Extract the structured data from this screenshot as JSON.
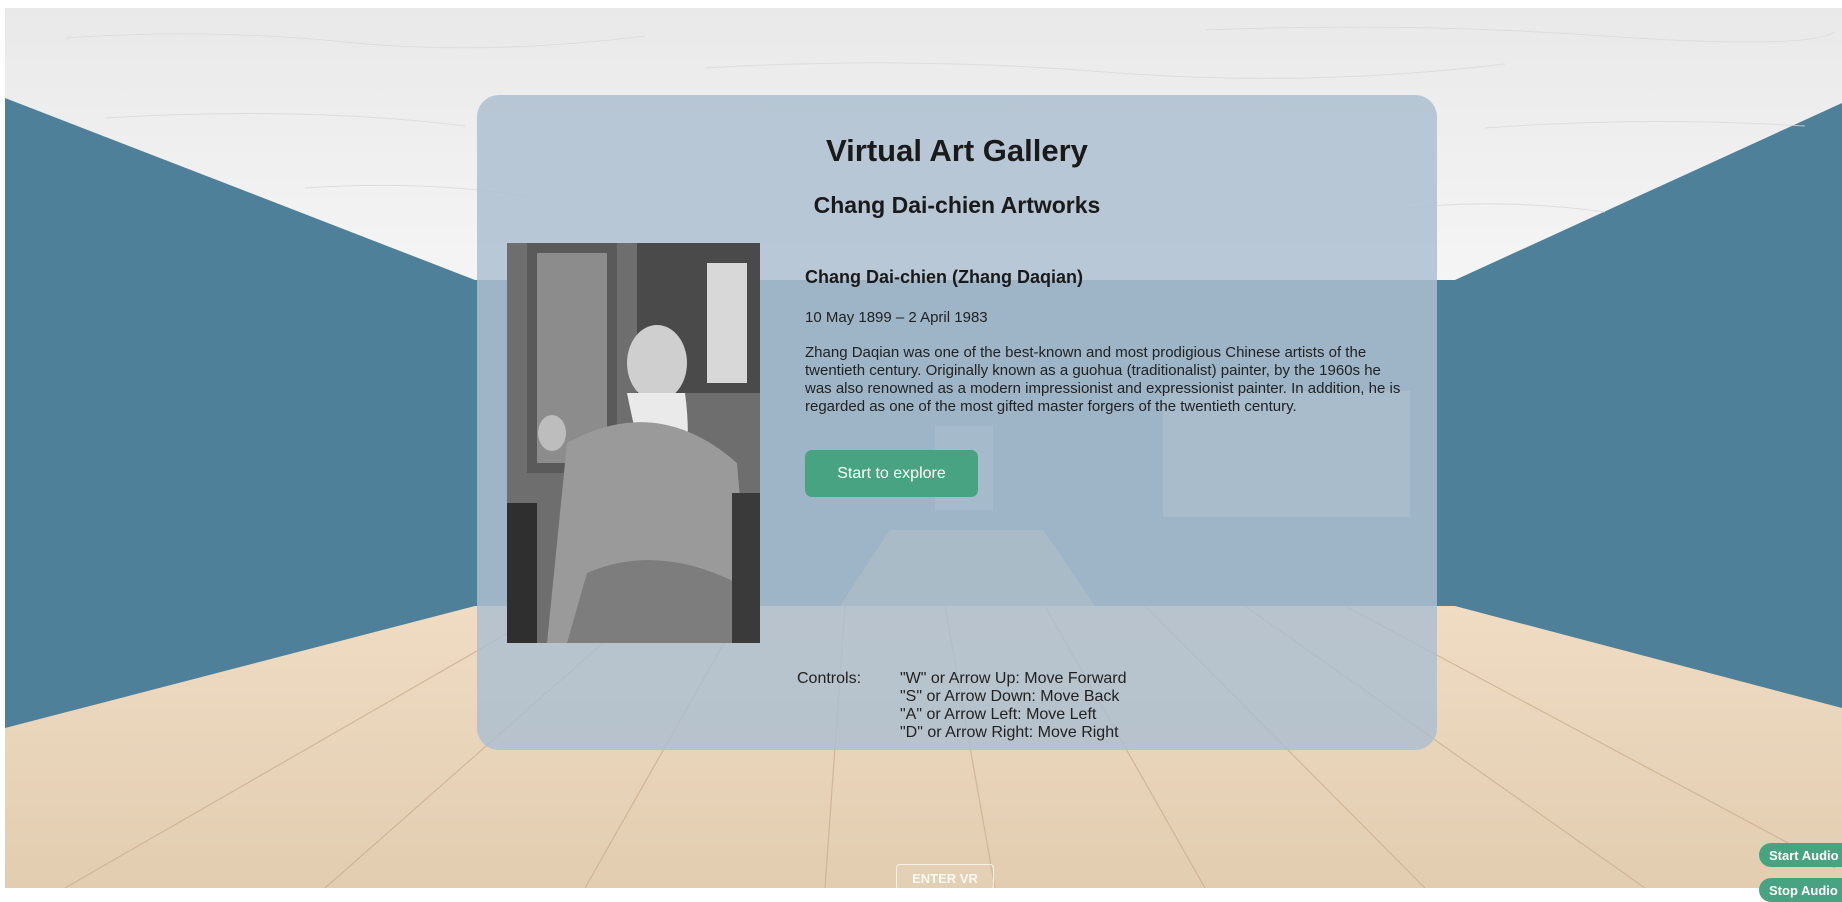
{
  "gallery": {
    "title": "Virtual Art Gallery",
    "subtitle": "Chang Dai-chien Artworks"
  },
  "artist": {
    "name": "Chang Dai-chien (Zhang Daqian)",
    "dates": "10 May 1899 – 2 April 1983",
    "bio": "Zhang Daqian was one of the best-known and most prodigious Chinese artists of the twentieth century. Originally known as a guohua (traditionalist) painter, by the 1960s he was also renowned as a modern impressionist and expressionist painter. In addition, he is regarded as one of the most gifted master forgers of the twentieth century."
  },
  "actions": {
    "explore_label": "Start to explore",
    "enter_vr_label": "ENTER VR",
    "audio_start_label": "Start Audio Guide",
    "audio_stop_label": "Stop Audio Guide"
  },
  "controls": {
    "label": "Controls:",
    "items": [
      "\"W\" or Arrow Up: Move Forward",
      "\"S\" or Arrow Down: Move Back",
      "\"A\" or Arrow Left: Move Left",
      "\"D\" or Arrow Right: Move Right"
    ]
  },
  "colors": {
    "wall": "#4e8099",
    "ceiling": "#ececec",
    "floor": "#e6d0b4",
    "accent": "#48a383",
    "panel": "#adbfcf"
  }
}
